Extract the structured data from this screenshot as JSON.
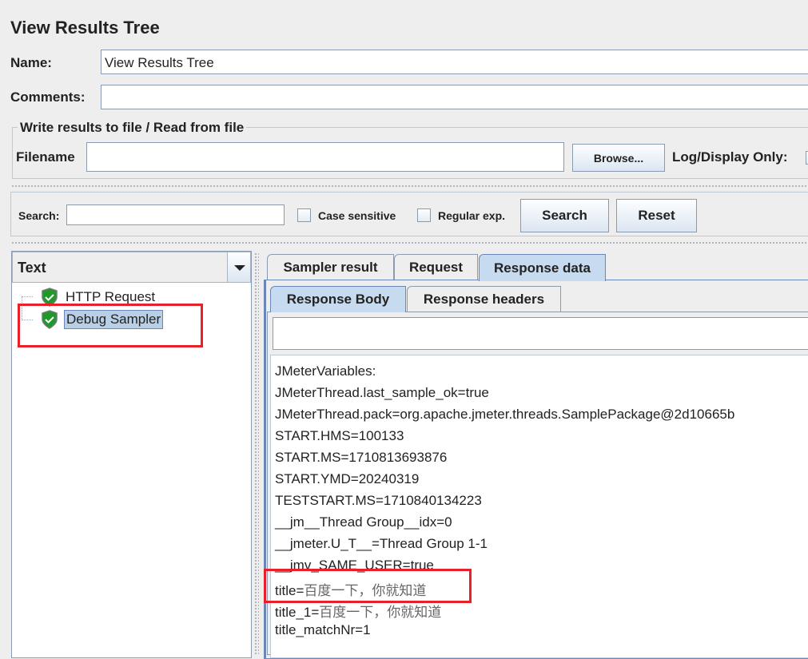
{
  "header": {
    "title": "View Results Tree",
    "name_label": "Name:",
    "name_value": "View Results Tree",
    "comments_label": "Comments:",
    "comments_value": ""
  },
  "file": {
    "group_title": "Write results to file / Read from file",
    "filename_label": "Filename",
    "filename_value": "",
    "browse": "Browse...",
    "log_display": "Log/Display Only:"
  },
  "search": {
    "label": "Search:",
    "value": "",
    "case_sensitive": "Case sensitive",
    "regex": "Regular exp.",
    "search_btn": "Search",
    "reset_btn": "Reset"
  },
  "tree": {
    "renderer": "Text",
    "items": [
      {
        "label": "HTTP Request",
        "icon": "success-shield-icon"
      },
      {
        "label": "Debug Sampler",
        "icon": "success-shield-icon",
        "selected": true
      }
    ]
  },
  "tabs": [
    "Sampler result",
    "Request",
    "Response data"
  ],
  "active_tab": "Response data",
  "subtabs": [
    "Response Body",
    "Response headers"
  ],
  "active_subtab": "Response Body",
  "response": {
    "lines": [
      "JMeterVariables:",
      "JMeterThread.last_sample_ok=true",
      "JMeterThread.pack=org.apache.jmeter.threads.SamplePackage@2d10665b",
      "START.HMS=100133",
      "START.MS=1710813693876",
      "START.YMD=20240319",
      "TESTSTART.MS=1710840134223",
      "__jm__Thread Group__idx=0",
      "__jmeter.U_T__=Thread Group 1-1",
      "__jmv_SAME_USER=true"
    ],
    "title_key": "title=",
    "title_val": "百度一下，你就知道",
    "title1_key": "title_1=",
    "title1_val": "百度一下，你就知道",
    "match": "title_matchNr=1"
  },
  "highlight_color": "#e8202a"
}
